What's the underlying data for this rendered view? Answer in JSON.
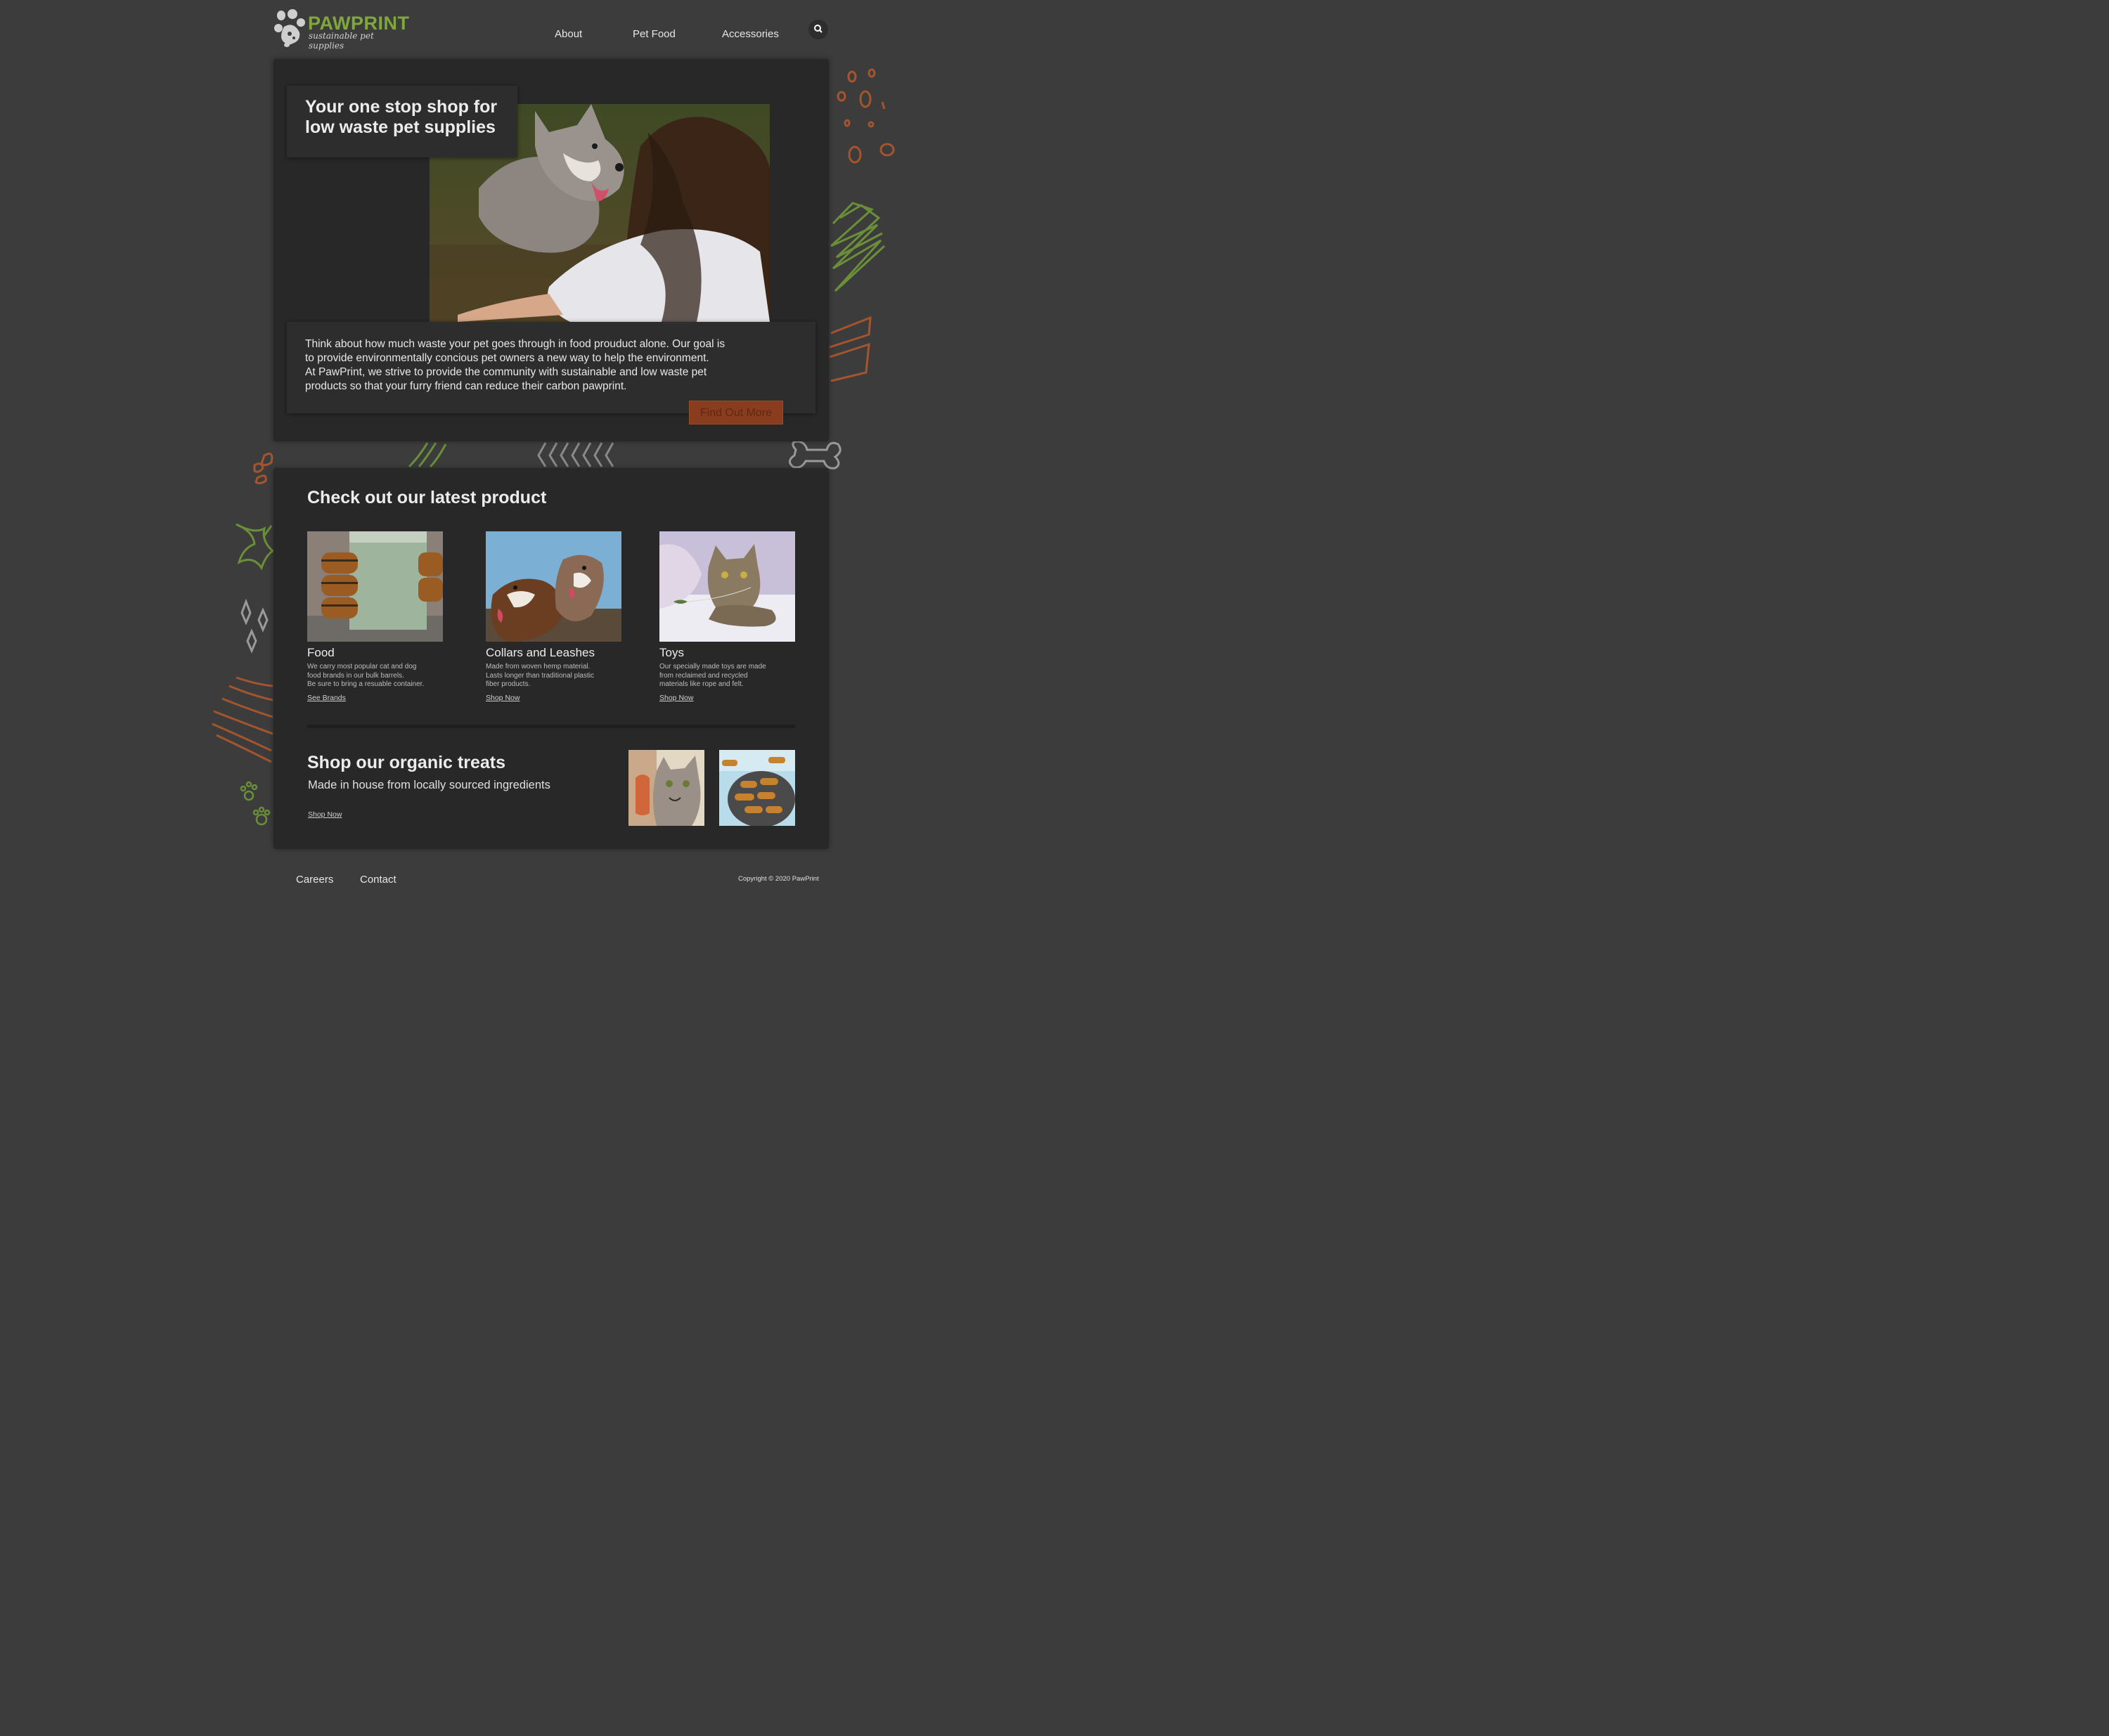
{
  "header": {
    "brand": "PAWPRINT",
    "tagline": "sustainable pet supplies",
    "nav": [
      {
        "label": "About"
      },
      {
        "label": "Pet Food"
      },
      {
        "label": "Accessories"
      }
    ],
    "search_icon": "search-icon"
  },
  "hero": {
    "headline_line1": "Your one stop shop for",
    "headline_line2": "low waste pet supplies",
    "image": "woman-with-dog-photo",
    "description_line1": "Think about how much waste your pet goes through in food prouduct alone. Our goal is",
    "description_line2": "to provide environmentally concious pet owners a new way to help the environment.",
    "description_line3": "At PawPrint, we strive to provide the community with sustainable and low waste pet",
    "description_line4": "products so that your furry friend can reduce their carbon pawprint.",
    "cta_label": "Find Out More"
  },
  "latest": {
    "title": "Check out our latest product",
    "products": [
      {
        "name": "Food",
        "image": "bulk-barrels-photo",
        "desc_line1": "We carry most popular cat and dog",
        "desc_line2": "food brands in our bulk barrels.",
        "desc_line3": "Be sure to bring a resuable container.",
        "link": "See Brands"
      },
      {
        "name": "Collars and Leashes",
        "image": "two-dogs-photo",
        "desc_line1": "Made from woven hemp material.",
        "desc_line2": "Lasts longer than traditional plastic",
        "desc_line3": "fiber products.",
        "link": "Shop Now"
      },
      {
        "name": "Toys",
        "image": "cat-with-toy-photo",
        "desc_line1": "Our specially made toys are made",
        "desc_line2": "from reclaimed and recycled",
        "desc_line3": "materials like rope and felt.",
        "link": "Shop Now"
      }
    ]
  },
  "treats": {
    "title": "Shop our organic treats",
    "subtitle": "Made in house from locally sourced ingredients",
    "link": "Shop Now",
    "images": [
      "cat-eating-treat-photo",
      "bone-biscuits-photo"
    ]
  },
  "footer": {
    "links": [
      {
        "label": "Careers"
      },
      {
        "label": "Contact"
      }
    ],
    "copyright": "Copyright © 2020 PawPrint"
  },
  "colors": {
    "background": "#3c3c3c",
    "card": "#282828",
    "brand_green": "#7fa83a",
    "accent_orange": "#a4552d",
    "button": "#8a3d1e"
  }
}
